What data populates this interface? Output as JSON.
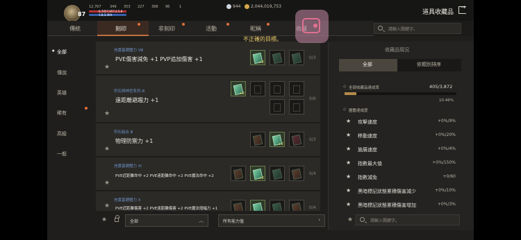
{
  "header": {
    "level": "87",
    "stats": [
      "12,767",
      "349",
      "353",
      "227",
      "398",
      "96",
      "1"
    ],
    "hp_text": "6,7457,957,2,5.8",
    "sub_text": "1,8,3,304",
    "currency_a": "944",
    "currency_b": "2,044,019,753",
    "panel_title": "道具收藏品"
  },
  "tabs": [
    "傳統",
    "刻印",
    "非刻印",
    "活動",
    "昵稱",
    "收藏"
  ],
  "search_placeholder": "請輸入關鍵字。",
  "error_message": "不正確的目標。",
  "categories": [
    "全部",
    "傳說",
    "英雄",
    "稀有",
    "高級",
    "一般"
  ],
  "rows": [
    {
      "sub": "充實基礎體力 Ⅷ",
      "main": "PVE傷害減免 +1 PVP追加傷害 +1",
      "count": "0/3"
    },
    {
      "sub": "符石與神官系列 Ⅲ",
      "main": "遠距離避趨力 +1",
      "count": "0/6"
    },
    {
      "sub": "符石組合 Ⅲ",
      "main": "物理防禦力 +1",
      "count": "0/3"
    },
    {
      "sub": "充實基礎體力 Ⅺ",
      "main": "PVE近距離命中 +2 PVE遠距離命中 +2 PVE魔法命中 +2",
      "count": "0/4"
    },
    {
      "sub": "充實基礎體力 Ⅹ",
      "main": "PVE近距離傷害 +2 PVE遠距離傷害 +2 PVE魔法增幅力 +1",
      "count": "0/4"
    }
  ],
  "filter": {
    "all": "全部",
    "ability": "所有能力值"
  },
  "right_panel": {
    "heading": "收藏品現況",
    "toggle": [
      "全部",
      "依類別排序"
    ],
    "achievement_label": "全部收藏品達成率",
    "achievement_value": "405/3,872",
    "achievement_percent": "10.46%",
    "achievement_fraction": 0.1046,
    "stats_heading": "圖鑑達成度",
    "stats": [
      {
        "label": "攻擊速度",
        "value": "+0%/9%"
      },
      {
        "label": "移動速度",
        "value": "+0%/20%"
      },
      {
        "label": "施展速度",
        "value": "+0%/4%"
      },
      {
        "label": "指數最大值",
        "value": "+0%/150%"
      },
      {
        "label": "指數減免",
        "value": "+0/60"
      },
      {
        "label": "黑暗標記狀態累積傷害減少",
        "value": "+0%/10%"
      },
      {
        "label": "黑暗標記狀態累積傷害增加",
        "value": "+0%/3%"
      }
    ]
  },
  "icons": {
    "search": "search-icon",
    "exit": "exit-icon",
    "star": "star-icon",
    "lock": "lock-icon",
    "overlay": "screen-record-icon"
  }
}
